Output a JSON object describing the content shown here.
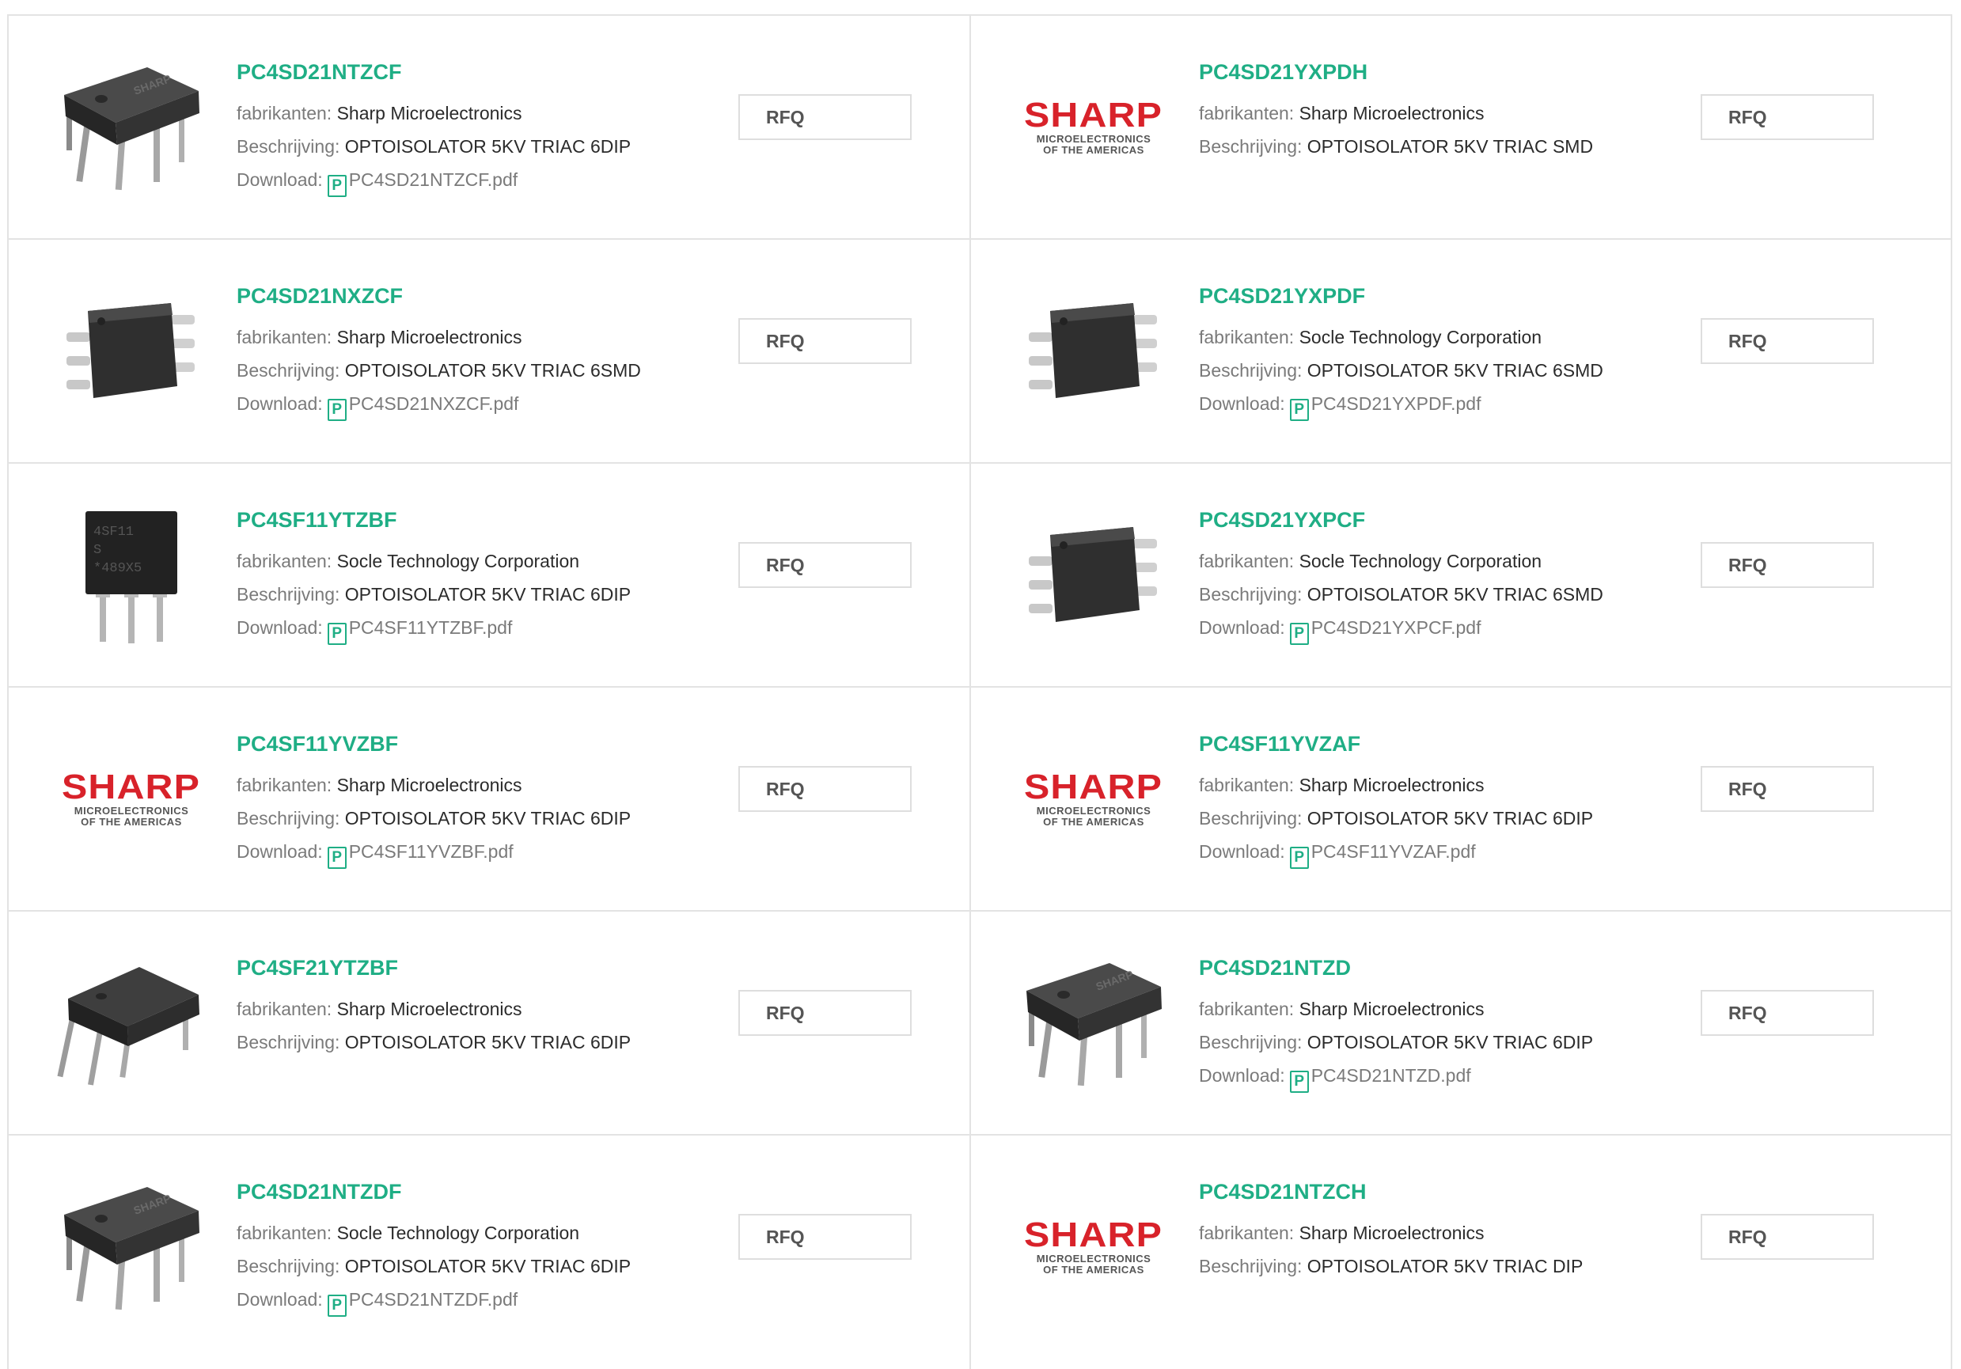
{
  "labels": {
    "manufacturer": "fabrikanten:",
    "description": "Beschrijving:",
    "download": "Download:",
    "pdf_glyph": "P",
    "rfq": "RFQ"
  },
  "sharp_logo": {
    "word": "SHARP",
    "sub1": "MICROELECTRONICS",
    "sub2": "OF THE AMERICAS"
  },
  "colors": {
    "title": "#1fae85",
    "brand_red": "#d8222a",
    "border": "#e3e3e3"
  },
  "products": [
    {
      "name": "PC4SD21NTZCF",
      "manufacturer": "Sharp Microelectronics",
      "description": "OPTOISOLATOR 5KV TRIAC 6DIP",
      "download": "PC4SD21NTZCF.pdf",
      "image": "dip6-chip-icon"
    },
    {
      "name": "PC4SD21YXPDH",
      "manufacturer": "Sharp Microelectronics",
      "description": "OPTOISOLATOR 5KV TRIAC SMD",
      "download": null,
      "image": "sharp-logo"
    },
    {
      "name": "PC4SD21NXZCF",
      "manufacturer": "Sharp Microelectronics",
      "description": "OPTOISOLATOR 5KV TRIAC 6SMD",
      "download": "PC4SD21NXZCF.pdf",
      "image": "smd6-chip-icon"
    },
    {
      "name": "PC4SD21YXPDF",
      "manufacturer": "Socle Technology Corporation",
      "description": "OPTOISOLATOR 5KV TRIAC 6SMD",
      "download": "PC4SD21YXPDF.pdf",
      "image": "smd6-chip-icon"
    },
    {
      "name": "PC4SF11YTZBF",
      "manufacturer": "Socle Technology Corporation",
      "description": "OPTOISOLATOR 5KV TRIAC 6DIP",
      "download": "PC4SF11YTZBF.pdf",
      "image": "dip6-front-chip-icon"
    },
    {
      "name": "PC4SD21YXPCF",
      "manufacturer": "Socle Technology Corporation",
      "description": "OPTOISOLATOR 5KV TRIAC 6SMD",
      "download": "PC4SD21YXPCF.pdf",
      "image": "smd6-chip-icon"
    },
    {
      "name": "PC4SF11YVZBF",
      "manufacturer": "Sharp Microelectronics",
      "description": "OPTOISOLATOR 5KV TRIAC 6DIP",
      "download": "PC4SF11YVZBF.pdf",
      "image": "sharp-logo"
    },
    {
      "name": "PC4SF11YVZAF",
      "manufacturer": "Sharp Microelectronics",
      "description": "OPTOISOLATOR 5KV TRIAC 6DIP",
      "download": "PC4SF11YVZAF.pdf",
      "image": "sharp-logo"
    },
    {
      "name": "PC4SF21YTZBF",
      "manufacturer": "Sharp Microelectronics",
      "description": "OPTOISOLATOR 5KV TRIAC 6DIP",
      "download": null,
      "image": "dip6-side-chip-icon"
    },
    {
      "name": "PC4SD21NTZD",
      "manufacturer": "Sharp Microelectronics",
      "description": "OPTOISOLATOR 5KV TRIAC 6DIP",
      "download": "PC4SD21NTZD.pdf",
      "image": "dip6-chip-icon"
    },
    {
      "name": "PC4SD21NTZDF",
      "manufacturer": "Socle Technology Corporation",
      "description": "OPTOISOLATOR 5KV TRIAC 6DIP",
      "download": "PC4SD21NTZDF.pdf",
      "image": "dip6-chip-icon"
    },
    {
      "name": "PC4SD21NTZCH",
      "manufacturer": "Sharp Microelectronics",
      "description": "OPTOISOLATOR 5KV TRIAC DIP",
      "download": null,
      "image": "sharp-logo"
    }
  ]
}
